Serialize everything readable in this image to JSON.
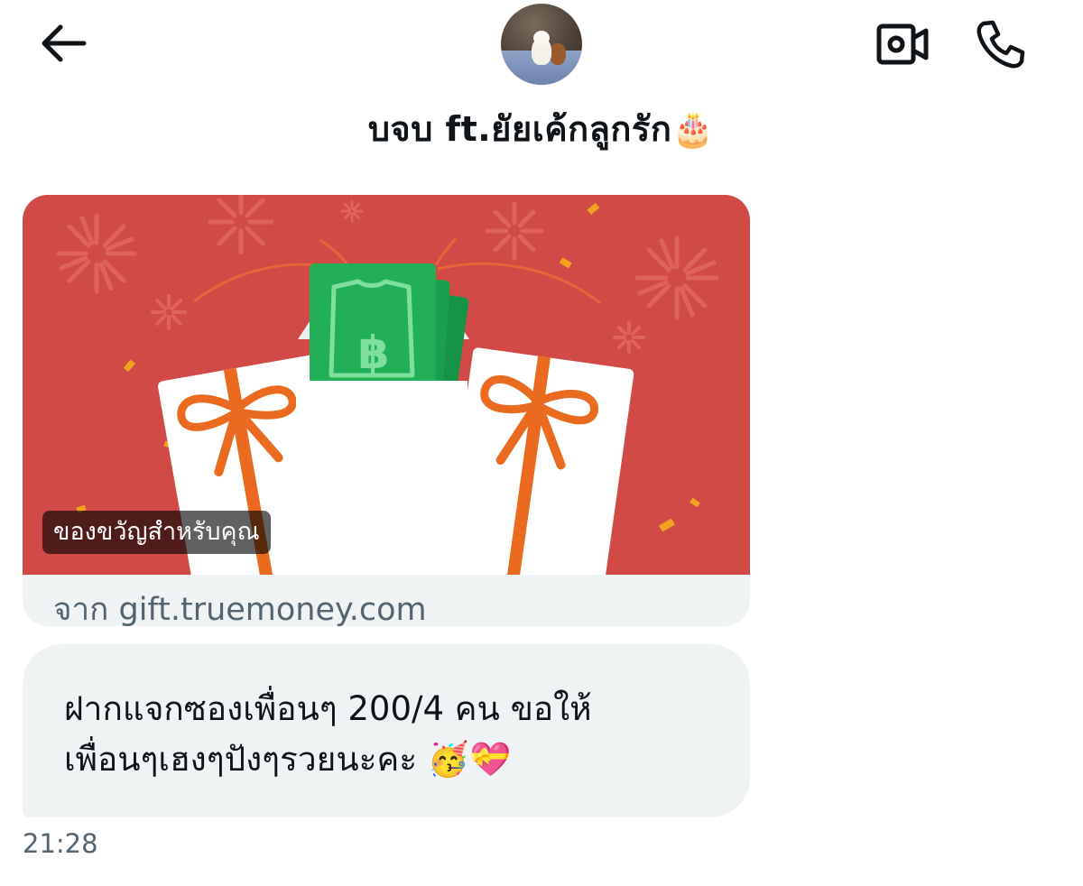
{
  "header": {
    "back_icon": "arrow-left-icon",
    "avatar_alt": "profile photo",
    "title": "บจบ ft.ยัยเค้กลูกรัก",
    "title_emoji": "🎂",
    "video_icon": "video-camera-icon",
    "call_icon": "phone-icon"
  },
  "link_card": {
    "tag": "ของขวัญสำหรับคุณ",
    "source": "จาก gift.truemoney.com",
    "colors": {
      "background": "#d24a45",
      "ribbon": "#ea6a1f",
      "money": "#1fa64a"
    }
  },
  "message": {
    "line1": "ฝากแจกซองเพื่อนๆ 200/4 คน ขอให้",
    "line2": "เพื่อนๆเฮงๆปังๆรวยนะคะ 🥳💝",
    "timestamp": "21:28"
  },
  "colors": {
    "text": "#0f1419",
    "secondary": "#536471",
    "bubble": "#eff3f4"
  }
}
